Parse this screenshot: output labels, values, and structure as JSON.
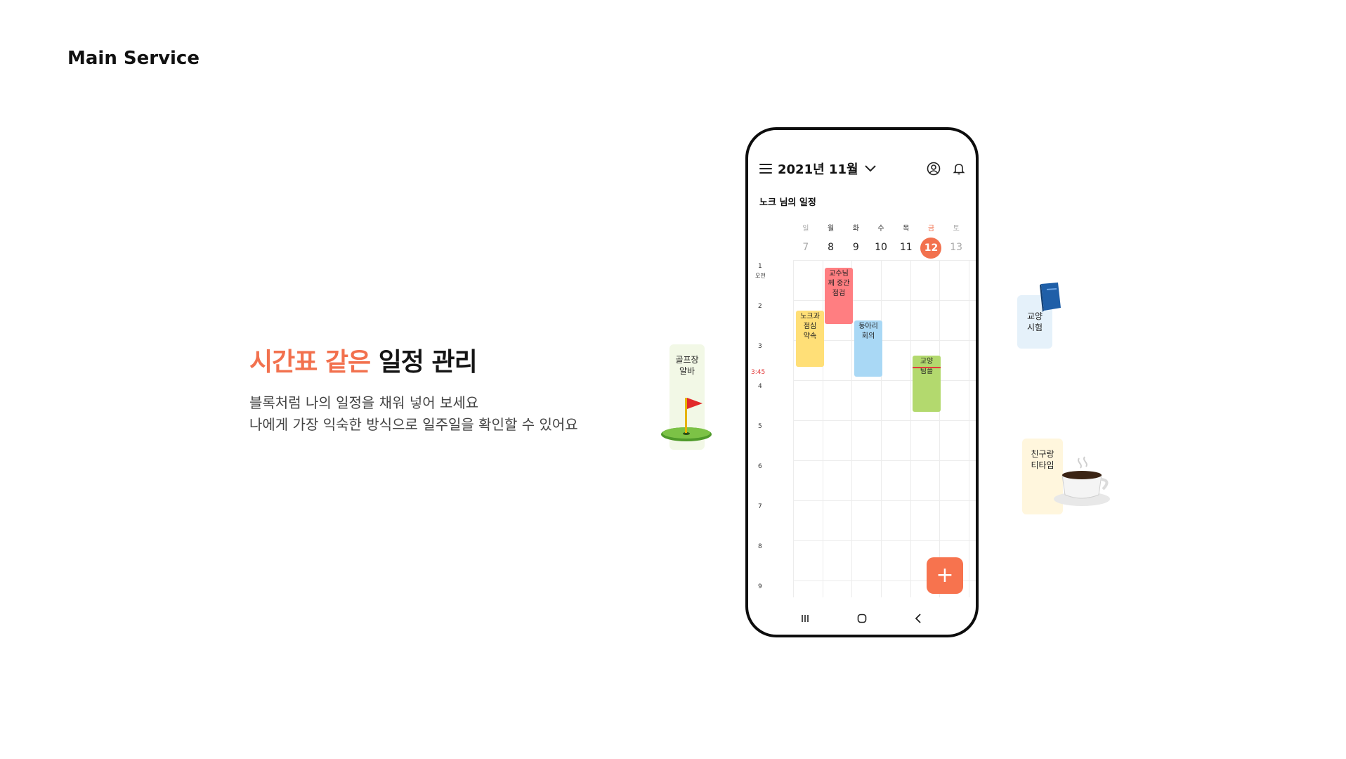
{
  "page_label": "Main Service",
  "hero": {
    "title_accent": "시간표 같은",
    "title_rest": "일정 관리",
    "line1": "블록처럼 나의 일정을 채워 넣어 보세요",
    "line2": "나에게 가장 익숙한 방식으로 일주일을 확인할 수 있어요"
  },
  "app": {
    "month_label": "2021년 11월",
    "owner_title": "노크 님의 일정",
    "weekdays": [
      "일",
      "월",
      "화",
      "수",
      "목",
      "금",
      "토"
    ],
    "dates": [
      "7",
      "8",
      "9",
      "10",
      "11",
      "12",
      "13"
    ],
    "today": "12",
    "hours": [
      "1",
      "2",
      "3",
      "4",
      "5",
      "6",
      "7",
      "8",
      "9"
    ],
    "am_label": "오전",
    "now_label": "3:45",
    "events": [
      {
        "line1": "노크과",
        "line2": "점심",
        "line3": "약속",
        "color": "#FFDF77"
      },
      {
        "line1": "교수님",
        "line2": "께 중간",
        "line3": "점검",
        "color": "#FF7E81"
      },
      {
        "line1": "동아리",
        "line2": "회의",
        "color": "#A9D8F5"
      },
      {
        "line1": "교양",
        "line2": "팀플",
        "color": "#B3D96E"
      }
    ],
    "accent_color": "#F2714E"
  },
  "stickers": {
    "golf": {
      "line1": "골프장",
      "line2": "알바",
      "color": "#F2F8E6"
    },
    "exam": {
      "line1": "교양",
      "line2": "시험",
      "color": "#E5F1FA"
    },
    "tea": {
      "line1": "친구랑",
      "line2": "티타임",
      "color": "#FFF6DD"
    }
  },
  "icons": [
    "menu-icon",
    "chevron-down-icon",
    "profile-icon",
    "bell-icon",
    "plus-icon",
    "recent-apps-icon",
    "home-icon",
    "back-icon",
    "golf-flag-icon",
    "book-icon",
    "coffee-cup-icon"
  ]
}
